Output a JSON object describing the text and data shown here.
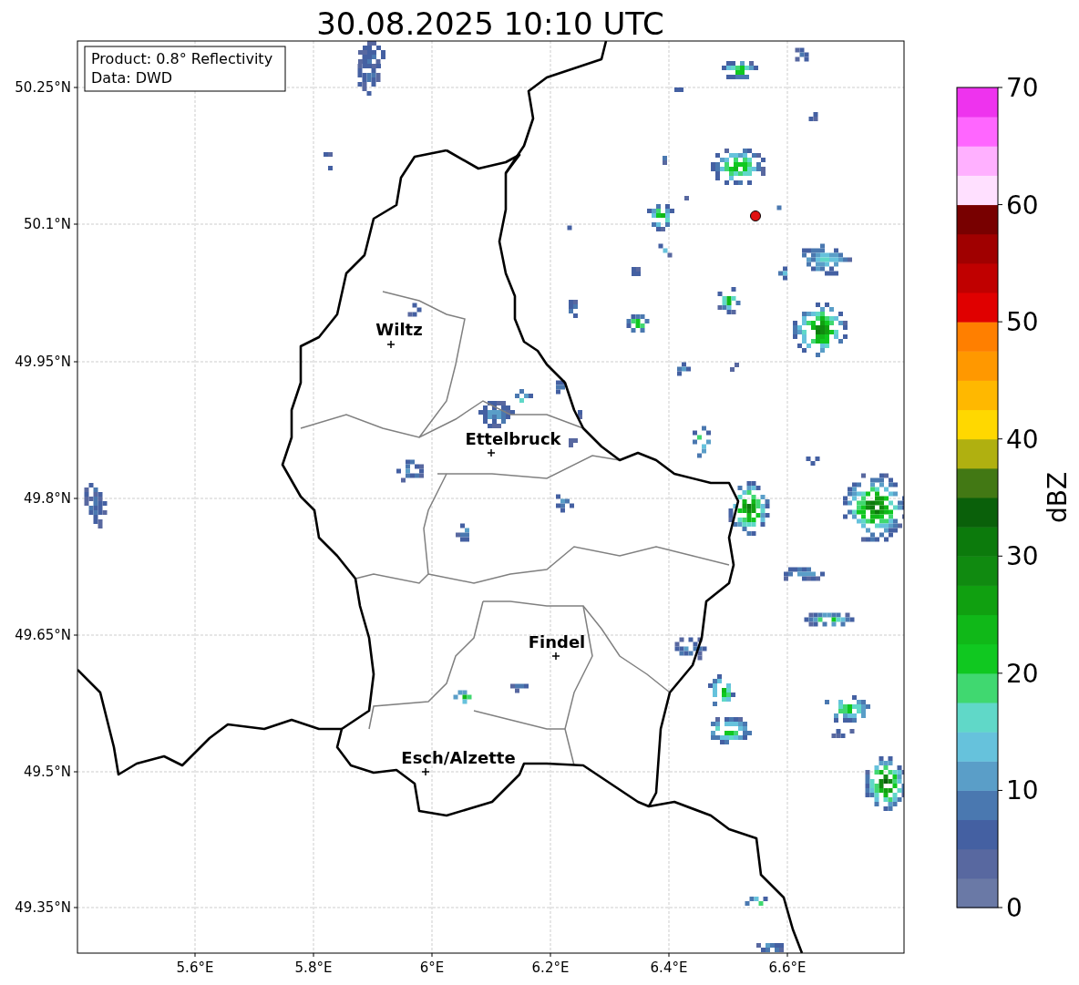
{
  "title": "30.08.2025 10:10 UTC",
  "info_box": {
    "lines": [
      "Product: 0.8° Reflectivity",
      "Data: DWD"
    ]
  },
  "cities": [
    {
      "name": "Wiltz"
    },
    {
      "name": "Ettelbruck"
    },
    {
      "name": "Findel"
    },
    {
      "name": "Esch/Alzette"
    }
  ],
  "lat_ticks": [
    "50.25°N",
    "50.1°N",
    "49.95°N",
    "49.8°N",
    "49.65°N",
    "49.5°N",
    "49.35°N"
  ],
  "lon_ticks": [
    "5.6°E",
    "5.8°E",
    "6°E",
    "6.2°E",
    "6.4°E",
    "6.6°E"
  ],
  "colorbar": {
    "label": "dBZ",
    "ticks": [
      "70",
      "60",
      "50",
      "40",
      "30",
      "20",
      "10",
      "0"
    ],
    "segments": [
      {
        "color": "#6a79a6"
      },
      {
        "color": "#5868a0"
      },
      {
        "color": "#4460a2"
      },
      {
        "color": "#4a78b0"
      },
      {
        "color": "#5a9ec8"
      },
      {
        "color": "#66c2dc"
      },
      {
        "color": "#60d8c8"
      },
      {
        "color": "#40d870"
      },
      {
        "color": "#10c820"
      },
      {
        "color": "#10b818"
      },
      {
        "color": "#10a010"
      },
      {
        "color": "#108a10"
      },
      {
        "color": "#0c7a0c"
      },
      {
        "color": "#0a600a"
      },
      {
        "color": "#427814"
      },
      {
        "color": "#b0b010"
      },
      {
        "color": "#ffd800"
      },
      {
        "color": "#ffb800"
      },
      {
        "color": "#ff9800"
      },
      {
        "color": "#ff7f00"
      },
      {
        "color": "#e00000"
      },
      {
        "color": "#c00000"
      },
      {
        "color": "#a00000"
      },
      {
        "color": "#780000"
      },
      {
        "color": "#ffe0ff"
      },
      {
        "color": "#ffb0ff"
      },
      {
        "color": "#ff66ff"
      },
      {
        "color": "#ee33ee"
      }
    ]
  }
}
